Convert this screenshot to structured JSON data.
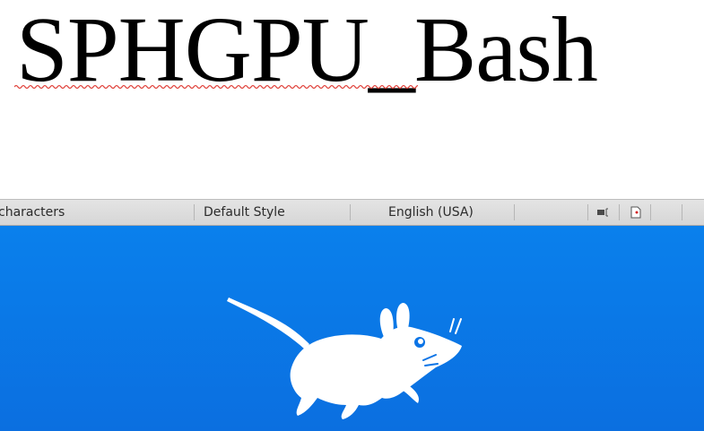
{
  "document": {
    "text": "SPHGPU_Bash"
  },
  "status_bar": {
    "word_count": "characters",
    "page_style": "Default Style",
    "language": "English (USA)",
    "icons": [
      "selection-mode-icon",
      "document-modified-icon"
    ]
  },
  "colors": {
    "desktop_blue": "#0a78ea",
    "statusbar_bg": "#dcdcdc",
    "spellcheck_red": "#e0413a"
  },
  "desktop": {
    "logo": "xfce-mouse-icon"
  }
}
